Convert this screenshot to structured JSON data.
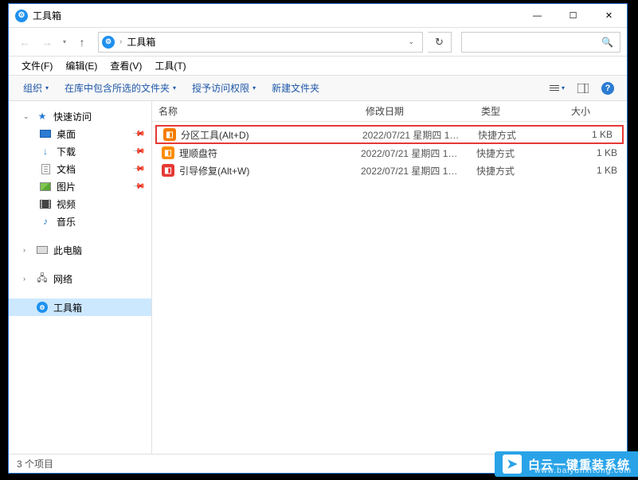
{
  "window": {
    "title": "工具箱",
    "minimize": "—",
    "maximize": "☐",
    "close": "✕"
  },
  "nav": {
    "back": "←",
    "forward": "→",
    "history_drop": "▾",
    "up": "↑",
    "separator": "›",
    "location": "工具箱",
    "addr_drop": "⌄",
    "refresh": "↻",
    "search_icon": "🔍"
  },
  "menubar": {
    "file": "文件(F)",
    "edit": "编辑(E)",
    "view": "查看(V)",
    "tools": "工具(T)"
  },
  "toolbar": {
    "organize": "组织",
    "include_in_library": "在库中包含所选的文件夹",
    "grant_access": "授予访问权限",
    "new_folder": "新建文件夹",
    "drop": "▾",
    "view_drop": "▾",
    "help": "?"
  },
  "sidebar": {
    "quick_access": "快速访问",
    "desktop": "桌面",
    "downloads": "下载",
    "documents": "文档",
    "pictures": "图片",
    "videos": "视频",
    "music": "音乐",
    "this_pc": "此电脑",
    "network": "网络",
    "toolbox": "工具箱",
    "pin": "📌",
    "caret_down": "⌄",
    "caret_right": "›"
  },
  "columns": {
    "name": "名称",
    "date": "修改日期",
    "type": "类型",
    "size": "大小"
  },
  "files": [
    {
      "name": "分区工具(Alt+D)",
      "date": "2022/07/21 星期四 1…",
      "type": "快捷方式",
      "size": "1 KB",
      "icon": "fi-orange"
    },
    {
      "name": "理顺盘符",
      "date": "2022/07/21 星期四 1…",
      "type": "快捷方式",
      "size": "1 KB",
      "icon": "fi-orange2"
    },
    {
      "name": "引导修复(Alt+W)",
      "date": "2022/07/21 星期四 1…",
      "type": "快捷方式",
      "size": "1 KB",
      "icon": "fi-red"
    }
  ],
  "statusbar": {
    "item_count": "3 个项目"
  },
  "watermark": {
    "brand": "白云一键重装系统",
    "url": "www.baiyunxitong.com",
    "icon": "➤"
  }
}
